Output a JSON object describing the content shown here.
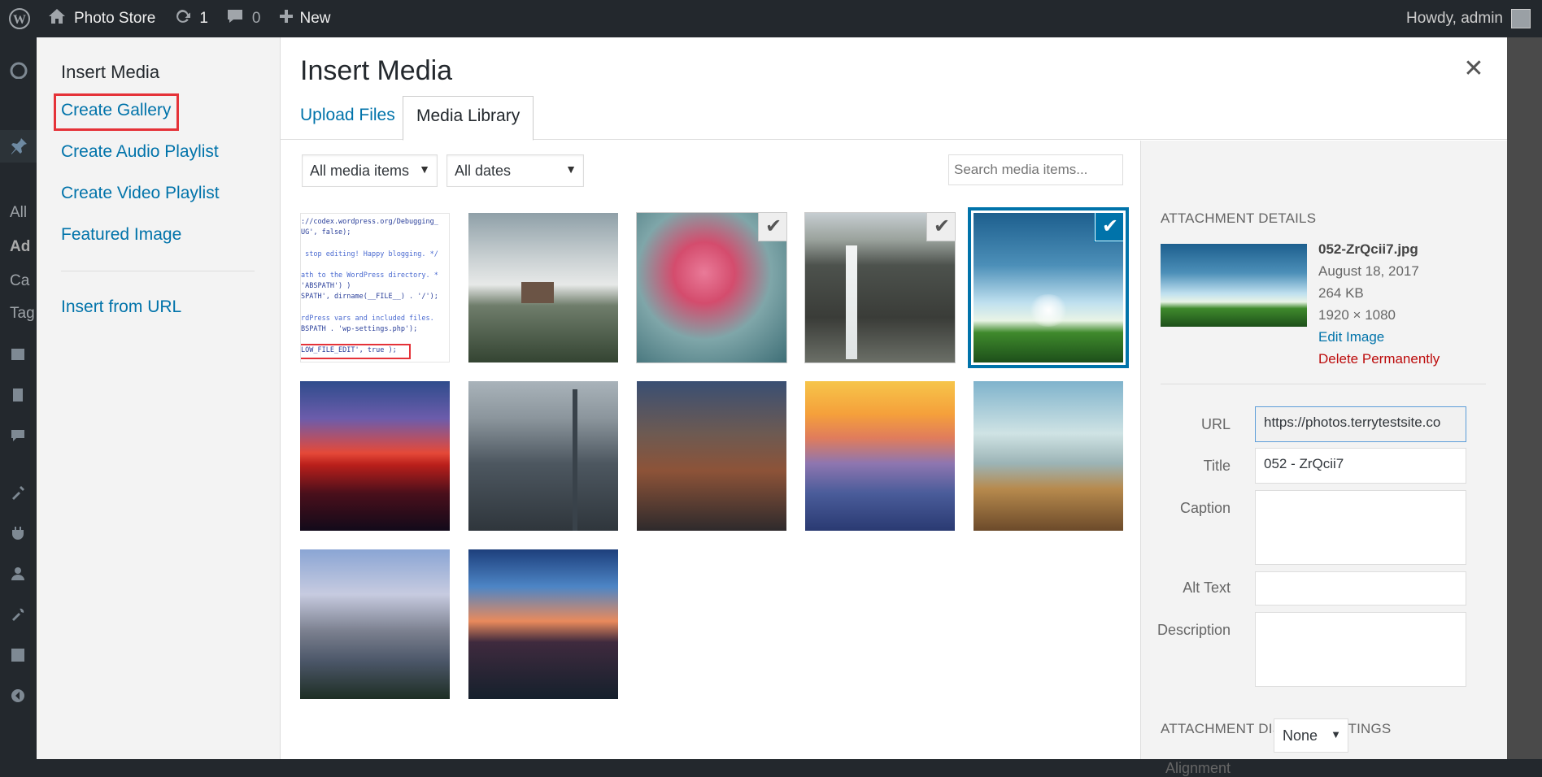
{
  "adminbar": {
    "site_name": "Photo Store",
    "updates_count": "1",
    "comments_count": "0",
    "new_label": "New",
    "howdy": "Howdy, admin"
  },
  "admin_menu_fragments": [
    "All",
    "Ad",
    "Ca",
    "Tag"
  ],
  "media_menu": {
    "heading": "Insert Media",
    "links": [
      "Create Gallery",
      "Create Audio Playlist",
      "Create Video Playlist",
      "Featured Image"
    ],
    "insert_from_url": "Insert from URL"
  },
  "frame": {
    "title": "Insert Media",
    "tabs": [
      "Upload Files",
      "Media Library"
    ],
    "close_glyph": "✕"
  },
  "toolbar": {
    "filter_type": "All media items",
    "filter_date": "All dates",
    "search_placeholder": "Search media items..."
  },
  "code_thumb_lines": [
    "://codex.wordpress.org/Debugging_",
    "UG', false);",
    "",
    " stop editing! Happy blogging. */",
    "",
    "ath to the WordPress directory. *",
    "'ABSPATH') )",
    "SPATH', dirname(__FILE__) . '/');",
    "",
    "rdPress vars and included files.",
    "BSPATH . 'wp-settings.php');",
    "",
    "LOW_FILE_EDIT', true );"
  ],
  "attachment": {
    "heading": "Attachment Details",
    "filename": "052-ZrQcii7.jpg",
    "date": "August 18, 2017",
    "size": "264 KB",
    "dimensions": "1920 × 1080",
    "edit_link": "Edit Image",
    "delete_link": "Delete Permanently",
    "fields": {
      "url_label": "URL",
      "url_value": "https://photos.terrytestsite.co",
      "title_label": "Title",
      "title_value": "052 - ZrQcii7",
      "caption_label": "Caption",
      "alt_label": "Alt Text",
      "description_label": "Description"
    }
  },
  "display_settings": {
    "heading": "Attachment Display Settings",
    "alignment_label": "Alignment",
    "alignment_value": "None"
  },
  "colors": {
    "link": "#0073aa",
    "delete": "#bc0b0b",
    "highlight_box": "#e53238",
    "adminbar": "#23282d"
  }
}
